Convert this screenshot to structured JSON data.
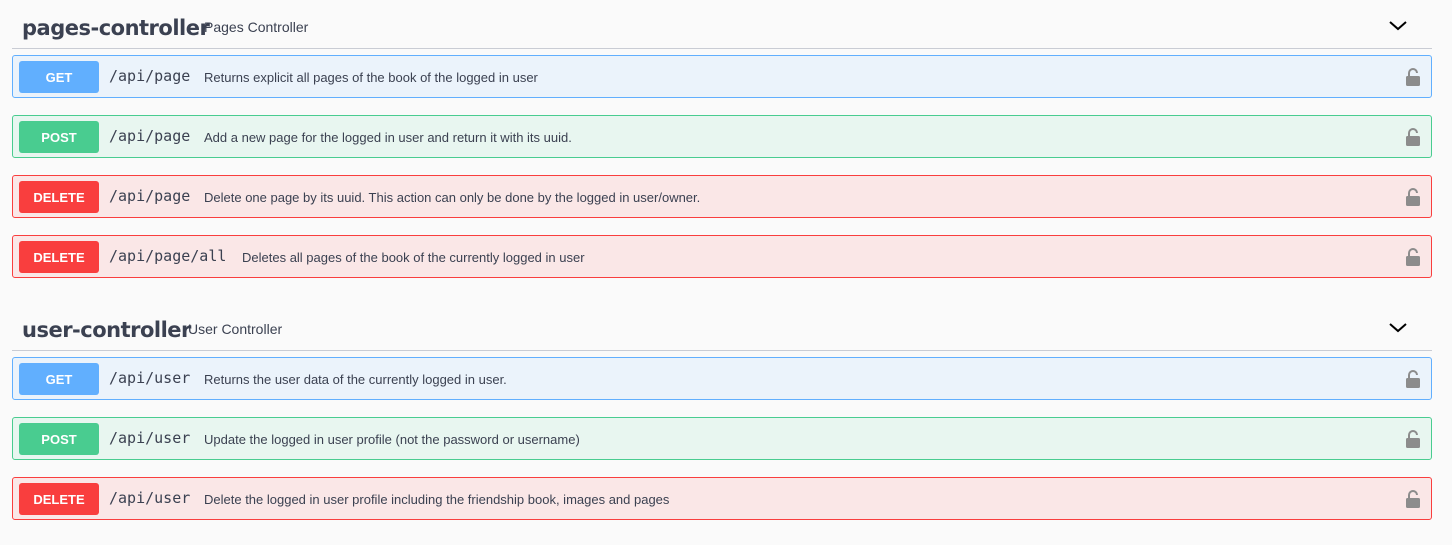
{
  "sections": [
    {
      "name": "pages-controller",
      "description": "Pages Controller",
      "operations": [
        {
          "method": "GET",
          "path": "/api/page",
          "summary": "Returns explicit all pages of the book of the logged in user"
        },
        {
          "method": "POST",
          "path": "/api/page",
          "summary": "Add a new page for the logged in user and return it with its uuid."
        },
        {
          "method": "DELETE",
          "path": "/api/page",
          "summary": "Delete one page by its uuid. This action can only be done by the logged in user/owner."
        },
        {
          "method": "DELETE",
          "path": "/api/page/all",
          "summary": "Deletes all pages of the book of the currently logged in user"
        }
      ]
    },
    {
      "name": "user-controller",
      "description": "User Controller",
      "operations": [
        {
          "method": "GET",
          "path": "/api/user",
          "summary": "Returns the user data of the currently logged in user."
        },
        {
          "method": "POST",
          "path": "/api/user",
          "summary": "Update the logged in user profile (not the password or username)"
        },
        {
          "method": "DELETE",
          "path": "/api/user",
          "summary": "Delete the logged in user profile including the friendship book, images and pages"
        }
      ]
    }
  ],
  "icons": {
    "toggle": "chevron-down-icon",
    "lock": "lock-icon"
  },
  "colors": {
    "get": "#61affe",
    "post": "#49cc90",
    "delete": "#f93e3e",
    "text": "#3b4151"
  }
}
